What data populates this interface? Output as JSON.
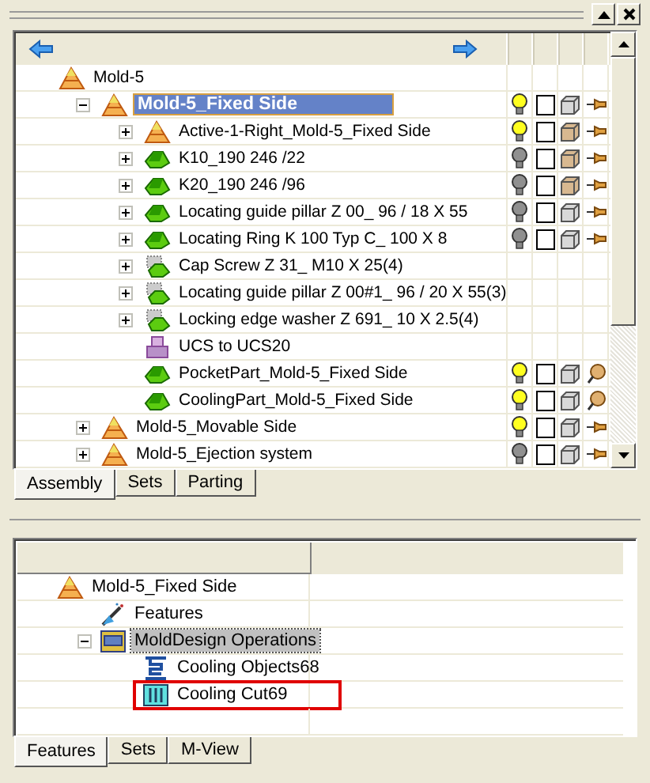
{
  "assembly_tree": [
    {
      "label": "Mold-5",
      "kind": "assembly",
      "selected": false,
      "children": [
        {
          "label": "Mold-5_Fixed Side",
          "kind": "assembly",
          "expanded": true,
          "selected": true,
          "status": {
            "lit": true,
            "checked": false,
            "shaded": false,
            "pinned": true
          },
          "children": [
            {
              "label": "Active-1-Right_Mold-5_Fixed Side",
              "kind": "assembly",
              "expanded": false,
              "selected": false,
              "status": {
                "lit": true,
                "checked": false,
                "shaded": true,
                "pinned": true
              }
            },
            {
              "label": "K10_190 246 /22",
              "kind": "part",
              "expanded": false,
              "selected": false,
              "status": {
                "lit": false,
                "checked": false,
                "shaded": true,
                "pinned": true
              }
            },
            {
              "label": "K20_190 246 /96",
              "kind": "part",
              "expanded": false,
              "selected": false,
              "status": {
                "lit": false,
                "checked": false,
                "shaded": true,
                "pinned": true
              }
            },
            {
              "label": "Locating guide pillar Z 00_ 96 / 18 X 55",
              "kind": "part",
              "expanded": false,
              "selected": false,
              "status": {
                "lit": false,
                "checked": false,
                "shaded": false,
                "pinned": true
              }
            },
            {
              "label": "Locating Ring K 100 Typ C_ 100 X 8",
              "kind": "part",
              "expanded": false,
              "selected": false,
              "status": {
                "lit": false,
                "checked": false,
                "shaded": false,
                "pinned": true
              }
            },
            {
              "label": "Cap Screw Z 31_ M10 X 25(4)",
              "kind": "group",
              "expanded": false,
              "selected": false
            },
            {
              "label": "Locating guide pillar Z 00#1_ 96 / 20 X 55(3)",
              "kind": "group",
              "expanded": false,
              "selected": false
            },
            {
              "label": "Locking edge washer Z 691_ 10 X 2.5(4)",
              "kind": "group",
              "expanded": false,
              "selected": false
            },
            {
              "label": "UCS to UCS20",
              "kind": "ucs",
              "selected": false
            },
            {
              "label": "PocketPart_Mold-5_Fixed Side",
              "kind": "part",
              "selected": false,
              "status": {
                "lit": true,
                "checked": false,
                "shaded": false,
                "pinned": false
              }
            },
            {
              "label": "CoolingPart_Mold-5_Fixed Side",
              "kind": "part",
              "selected": false,
              "status": {
                "lit": true,
                "checked": false,
                "shaded": false,
                "pinned": false
              }
            }
          ]
        },
        {
          "label": "Mold-5_Movable Side",
          "kind": "assembly",
          "expanded": false,
          "selected": false,
          "status": {
            "lit": true,
            "checked": false,
            "shaded": false,
            "pinned": true
          }
        },
        {
          "label": "Mold-5_Ejection system",
          "kind": "assembly",
          "expanded": false,
          "selected": false,
          "status": {
            "lit": false,
            "checked": false,
            "shaded": false,
            "pinned": true
          }
        }
      ]
    }
  ],
  "top_tabs": [
    {
      "label": "Assembly",
      "selected": true
    },
    {
      "label": "Sets",
      "selected": false
    },
    {
      "label": "Parting",
      "selected": false
    }
  ],
  "feature_tree": [
    {
      "label": "Mold-5_Fixed Side",
      "kind": "assembly",
      "selected": false,
      "children": [
        {
          "label": "Features",
          "kind": "features",
          "selected": false
        },
        {
          "label": "MoldDesign Operations",
          "kind": "operations",
          "expanded": true,
          "selected": true,
          "children": [
            {
              "label": "Cooling Objects68",
              "kind": "cooling-objects",
              "selected": false
            },
            {
              "label": "Cooling Cut69",
              "kind": "cooling-cut",
              "selected": false,
              "highlighted": true
            }
          ]
        }
      ]
    }
  ],
  "bottom_tabs": [
    {
      "label": "Features",
      "selected": true
    },
    {
      "label": "Sets",
      "selected": false
    },
    {
      "label": "M-View",
      "selected": false
    }
  ]
}
